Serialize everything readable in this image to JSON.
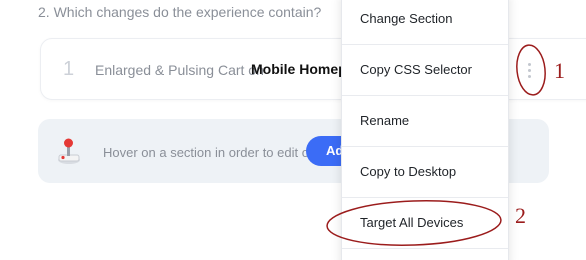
{
  "question": "2. Which changes do the experience contain?",
  "change": {
    "index": "1",
    "description": "Enlarged & Pulsing Cart on",
    "page": "Mobile Homep"
  },
  "hint": {
    "text": "Hover on a section in order to edit or",
    "button_label": "Ad"
  },
  "context_menu": {
    "items": [
      "Change Section",
      "Copy CSS Selector",
      "Rename",
      "Copy to Desktop",
      "Target All Devices"
    ]
  },
  "annotations": {
    "label_1": "1",
    "label_2": "2",
    "color": "#9b1c1c"
  },
  "colors": {
    "accent": "#3b6cf6",
    "hint_bg": "#eef2f6"
  }
}
